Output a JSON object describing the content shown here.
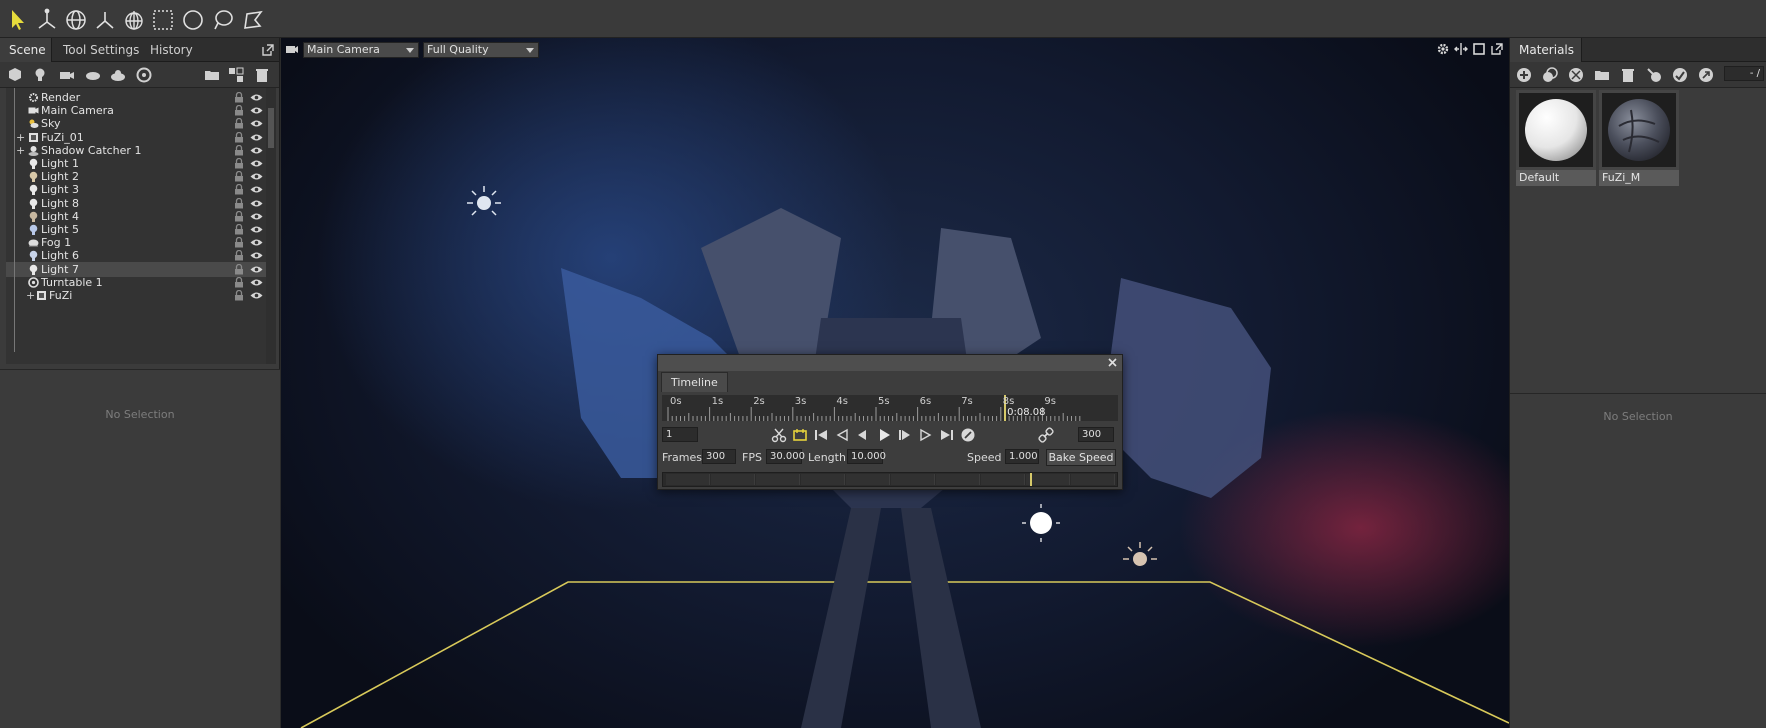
{
  "colors": {
    "accent": "#d6c96a",
    "panel": "#3b3b3b",
    "toolbar": "#3a3a3a",
    "floor_line": "#d8c95a"
  },
  "toolbar": {
    "tools": [
      "select-arrow-icon",
      "transform-gizmo-icon",
      "globe-icon",
      "axis-icon",
      "sphere-cage-icon",
      "marquee-select-icon",
      "lasso-circle-icon",
      "lasso-icon",
      "polygon-select-icon"
    ]
  },
  "left_panel": {
    "tabs": [
      "Scene",
      "Tool Settings",
      "History"
    ],
    "scene_items": [
      {
        "label": "Render",
        "icon": "gear-icon"
      },
      {
        "label": "Main Camera",
        "icon": "camera-icon"
      },
      {
        "label": "Sky",
        "icon": "sky-icon"
      },
      {
        "label": "FuZi_01",
        "icon": "mesh-icon"
      },
      {
        "label": "Shadow Catcher 1",
        "icon": "shadow-catcher-icon"
      },
      {
        "label": "Light 1",
        "icon": "light-bulb-icon"
      },
      {
        "label": "Light 2",
        "icon": "light-bulb-icon"
      },
      {
        "label": "Light 3",
        "icon": "light-bulb-icon"
      },
      {
        "label": "Light 8",
        "icon": "light-bulb-icon"
      },
      {
        "label": "Light 4",
        "icon": "light-bulb-icon"
      },
      {
        "label": "Light 5",
        "icon": "light-bulb-icon"
      },
      {
        "label": "Fog 1",
        "icon": "fog-icon"
      },
      {
        "label": "Light 6",
        "icon": "light-bulb-icon"
      },
      {
        "label": "Light 7",
        "icon": "light-bulb-icon"
      },
      {
        "label": "Turntable 1",
        "icon": "turntable-icon"
      },
      {
        "label": "FuZi",
        "icon": "mesh-icon"
      }
    ],
    "selected_item": "Light 7",
    "properties_empty": "No Selection"
  },
  "viewport": {
    "camera": "Main Camera",
    "quality": "Full Quality"
  },
  "timeline": {
    "tab": "Timeline",
    "ticks": [
      "0s",
      "1s",
      "2s",
      "3s",
      "4s",
      "5s",
      "6s",
      "7s",
      "8s",
      "9s"
    ],
    "current_time": "0:08.08",
    "current_fraction": 0.808,
    "start_frame": "1",
    "end_frame": "300",
    "frames_label": "Frames",
    "frames_value": "300",
    "fps_label": "FPS",
    "fps_value": "30.000",
    "length_label": "Length",
    "length_value": "10.000",
    "speed_label": "Speed",
    "speed_value": "1.000",
    "bake_label": "Bake Speed"
  },
  "right_panel": {
    "tab": "Materials",
    "page": "- /",
    "materials": [
      {
        "name": "Default"
      },
      {
        "name": "FuZi_M"
      }
    ],
    "properties_empty": "No Selection"
  }
}
